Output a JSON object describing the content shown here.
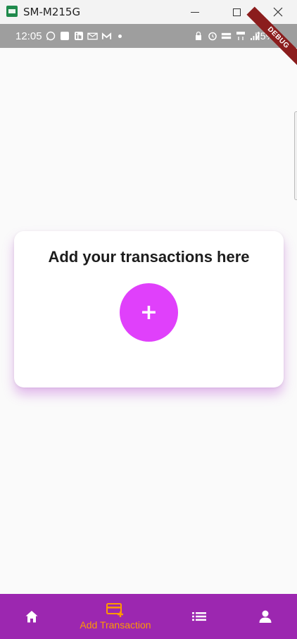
{
  "window": {
    "title": "SM-M215G",
    "minimize_icon": "minimize-icon",
    "maximize_icon": "maximize-icon",
    "close_icon": "close-icon"
  },
  "status_bar": {
    "time": "12:05",
    "battery": "75%",
    "debug_banner": "DEBUG"
  },
  "card": {
    "title": "Add your transactions here",
    "add_button_label": "+",
    "button_color": "#e040fb"
  },
  "bottom_nav": {
    "background": "#9c27b0",
    "active_color": "#ff9800",
    "items": [
      {
        "icon": "home-icon"
      },
      {
        "icon": "add-card-icon",
        "label": "Add Transaction",
        "active": true
      },
      {
        "icon": "list-icon"
      },
      {
        "icon": "person-icon"
      }
    ]
  }
}
